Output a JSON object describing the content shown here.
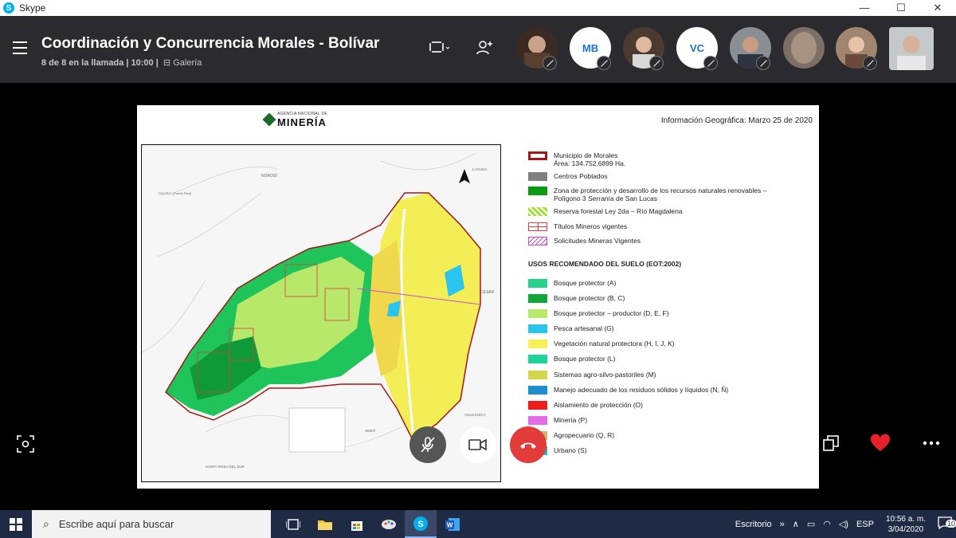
{
  "window": {
    "app_name": "Skype",
    "min": "—",
    "max": "☐",
    "close": "✕"
  },
  "call": {
    "title": "Coordinación y Concurrencia Morales - Bolívar",
    "status": "8 de 8 en la llamada | 10:00 |",
    "view": "Galería"
  },
  "participants": [
    {
      "initials": "",
      "color": "#3b2a22"
    },
    {
      "initials": "MB",
      "color": "#ffffff"
    },
    {
      "initials": "",
      "color": "#4a3a30"
    },
    {
      "initials": "VC",
      "color": "#ffffff"
    },
    {
      "initials": "",
      "color": "#8a8f94"
    },
    {
      "initials": "",
      "color": "#7d6f66"
    },
    {
      "initials": "",
      "color": "#a08570"
    }
  ],
  "slide": {
    "agency": "AGENCIA NACIONAL DE",
    "brand": "MINERÍA",
    "info": "Información Geográfica: Marzo 25 de 2020",
    "legend": [
      {
        "label": "Municipio de Morales",
        "label2": "Área: 134.752,6899 Ha.",
        "color": "#ffffff",
        "style": "outline"
      },
      {
        "label": "Centros Poblados",
        "label2": "",
        "color": "#808080",
        "style": "fill"
      },
      {
        "label": "Zona de protección y desarrollo de los recursos naturales renovables –",
        "label2": "Polígono 3 Serranía de San Lucas",
        "color": "#0a9a14",
        "style": "fill"
      },
      {
        "label": "Reserva forestal Ley 2da – Río Magdalena",
        "label2": "",
        "color": "#9be22c",
        "style": "hatch-green"
      },
      {
        "label": "Títulos Mineros vigentes",
        "label2": "",
        "color": "#e23a3a",
        "style": "grid"
      },
      {
        "label": "Solicitudes Mineras Vigentes",
        "label2": "",
        "color": "#c64fd1",
        "style": "hatch-purple"
      }
    ],
    "uses_heading": "USOS RECOMENDADO DEL SUELO  (EOT:2002)",
    "uses": [
      {
        "label": "Bosque protector (A)",
        "color": "#27d38b"
      },
      {
        "label": "Bosque protector (B, C)",
        "color": "#14a63b"
      },
      {
        "label": "Bosque protector – productor (D, E, F)",
        "color": "#b7ea6a"
      },
      {
        "label": "Pesca artesanal (G)",
        "color": "#29c5ef"
      },
      {
        "label": "Vegetación natural protectora (H, I, J, K)",
        "color": "#f6f154"
      },
      {
        "label": "Bosque protector (L)",
        "color": "#1ed39a"
      },
      {
        "label": "Sistemas agro-silvo-pastoriles (M)",
        "color": "#d4d44a"
      },
      {
        "label": "Manejo adecuado de los residuos sólidos y líquidos (N, Ñ)",
        "color": "#1c8fd0"
      },
      {
        "label": "Aislamiento de protección (O)",
        "color": "#ee1c1c"
      },
      {
        "label": "Minería (P)",
        "color": "#e46ae8"
      },
      {
        "label": "Agropecuario (Q, R)",
        "color": "#d1b464"
      },
      {
        "label": "Urbano (S)",
        "color": "#2ab9c8"
      }
    ],
    "map_labels": {
      "north": "N",
      "place1": "NOROSÍ",
      "place2": "TIQUISIO (Puerto Rico)",
      "place3": "SANTA ROSA DEL SUR",
      "place4": "SIMITÍ",
      "place5": "LAGUNA",
      "place6": "CESAR",
      "place7": "AGUACHICA"
    }
  },
  "taskbar": {
    "search_placeholder": "Escribe aquí para buscar",
    "desktop": "Escritorio",
    "lang": "ESP",
    "time": "10:56 a. m.",
    "date": "3/04/2020",
    "notifications": "10"
  }
}
